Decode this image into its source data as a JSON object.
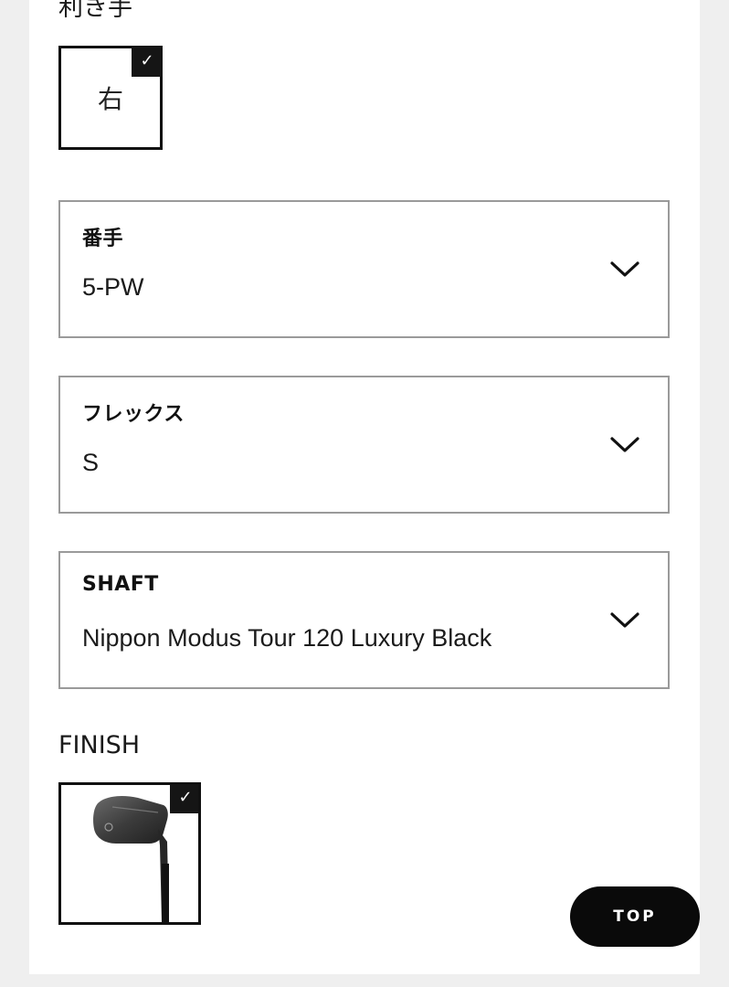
{
  "dominant_hand": {
    "label": "利き手",
    "option": "右",
    "selected": true,
    "check_glyph": "✓"
  },
  "club_number": {
    "label": "番手",
    "value": "5-PW"
  },
  "flex": {
    "label": "フレックス",
    "value": "S"
  },
  "shaft": {
    "label": "SHAFT",
    "value": "Nippon Modus Tour 120 Luxury Black"
  },
  "finish": {
    "label": "FINISH",
    "selected": true,
    "check_glyph": "✓",
    "swatch_icon": "iron-club-image"
  },
  "top_button": {
    "label": "TOP"
  },
  "colors": {
    "panel_bg": "#ffffff",
    "page_bg": "#efefef",
    "border_selected": "#111111",
    "border_select": "#9a9a9a",
    "top_button_bg": "#0a0a0a"
  }
}
